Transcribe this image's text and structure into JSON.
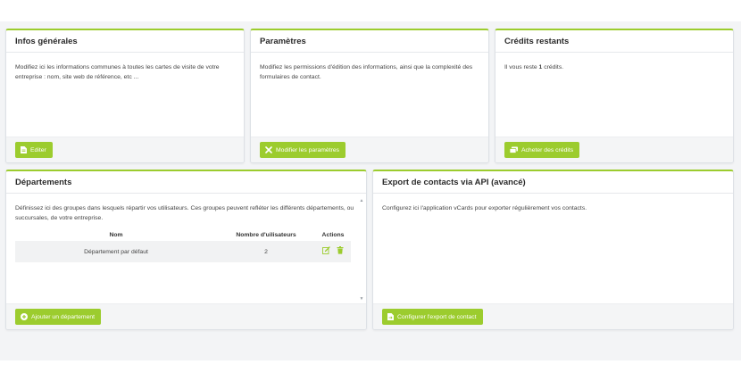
{
  "cards": {
    "infos": {
      "title": "Infos générales",
      "description": "Modifiez ici les informations communes à toutes les cartes de visite de votre entreprise : nom, site web de référence, etc ...",
      "button_label": "Editer",
      "button_icon": "file-edit-icon"
    },
    "params": {
      "title": "Paramètres",
      "description": "Modifiez les permissions d'édition des informations, ainsi que la complexité des formulaires de contact.",
      "button_label": "Modifier les paramètres",
      "button_icon": "tools-icon"
    },
    "credits": {
      "title": "Crédits restants",
      "text_before": "Il vous reste ",
      "count": "1",
      "text_after": " crédits.",
      "button_label": "Acheter des crédits",
      "button_icon": "money-icon"
    },
    "departments": {
      "title": "Départements",
      "description": "Définissez ici des groupes dans lesquels répartir vos utilisateurs. Ces groupes peuvent refléter les différents départements, ou succursales, de votre entreprise.",
      "columns": [
        "Nom",
        "Nombre d'uilisateurs",
        "Actions"
      ],
      "rows": [
        {
          "name": "Département par défaut",
          "users": "2"
        }
      ],
      "button_label": "Ajouter un département",
      "button_icon": "plus-circle-icon"
    },
    "export": {
      "title": "Export de contacts via API (avancé)",
      "description": "Configurez ici l'application vCards pour exporter régulièrement vos contacts.",
      "button_label": "Configurer l'export de contact",
      "button_icon": "file-export-icon"
    }
  },
  "colors": {
    "accent": "#9ccc2e",
    "background": "#f3f4f6",
    "card_border": "#dde1e6"
  }
}
